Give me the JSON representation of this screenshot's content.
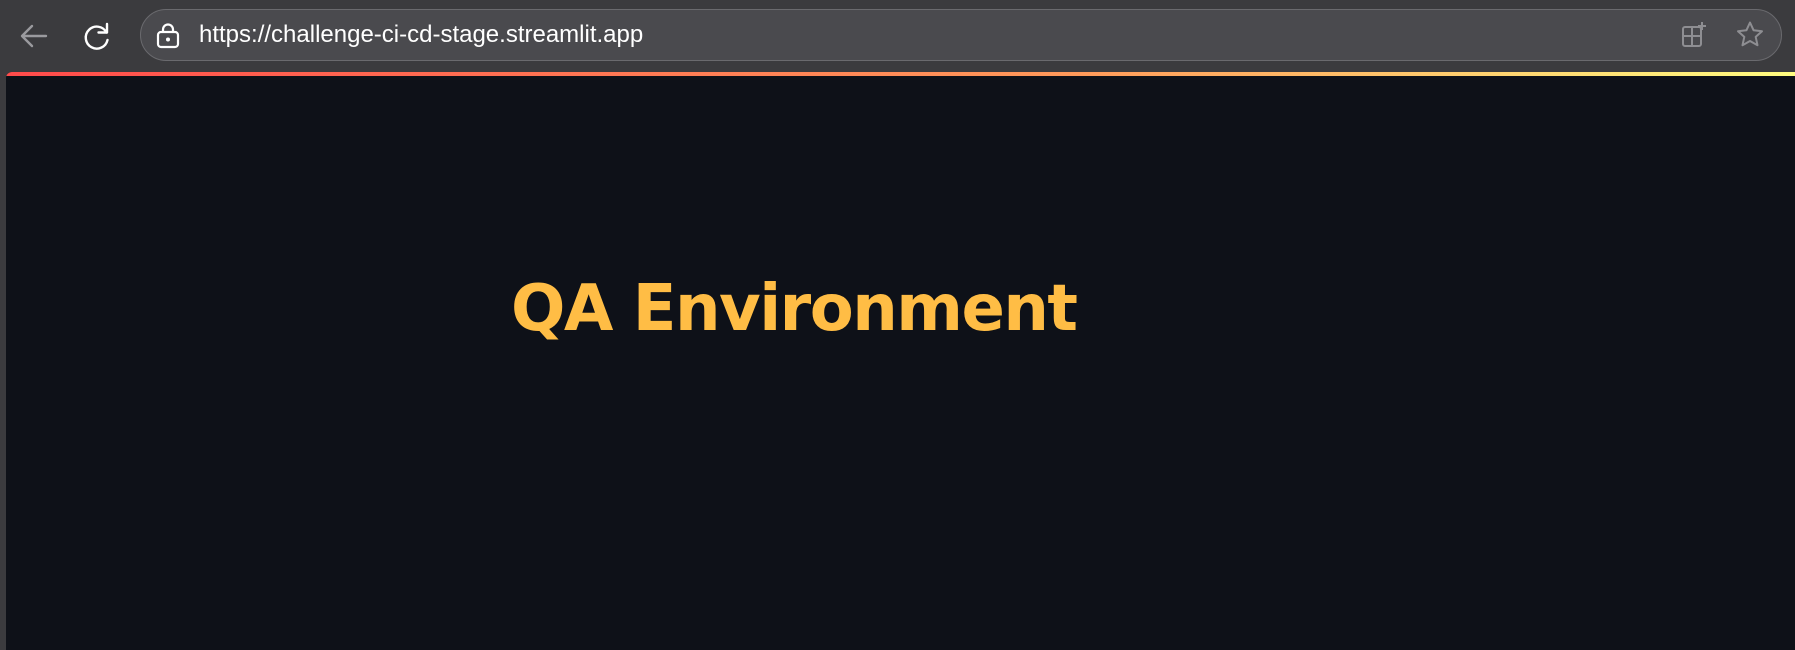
{
  "browser": {
    "url": "https://challenge-ci-cd-stage.streamlit.app",
    "icons": {
      "back": "back-arrow-icon",
      "reload": "reload-icon",
      "security": "lock-icon",
      "tabs": "add-to-collections-icon",
      "favorite": "star-icon"
    }
  },
  "app": {
    "title": "QA Environment",
    "title_color": "#ffbd45",
    "background_color": "#0e1118",
    "decoration_gradient": [
      "#ff4b4b",
      "#ff9a5a",
      "#fffd80"
    ]
  }
}
